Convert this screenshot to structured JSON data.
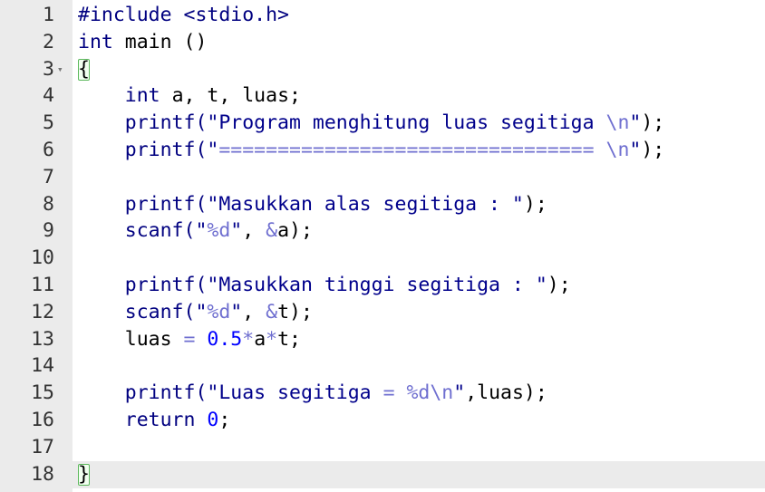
{
  "active_line": 18,
  "fold_line": 3,
  "fold_glyph": "▾",
  "lines": [
    {
      "n": "1",
      "tokens": [
        {
          "t": "#include <stdio.h>",
          "c": "kw"
        }
      ]
    },
    {
      "n": "2",
      "tokens": [
        {
          "t": "int",
          "c": "kw"
        },
        {
          "t": " main ()",
          "c": ""
        }
      ]
    },
    {
      "n": "3",
      "tokens": [
        {
          "t": "{",
          "c": "brace"
        }
      ]
    },
    {
      "n": "4",
      "tokens": [
        {
          "t": "    ",
          "c": ""
        },
        {
          "t": "int",
          "c": "kw"
        },
        {
          "t": " a, t, luas;",
          "c": ""
        }
      ]
    },
    {
      "n": "5",
      "tokens": [
        {
          "t": "    ",
          "c": ""
        },
        {
          "t": "printf(",
          "c": "kw"
        },
        {
          "t": "\"Program menghitung luas segitiga ",
          "c": "str"
        },
        {
          "t": "\\n",
          "c": "esc"
        },
        {
          "t": "\"",
          "c": "str"
        },
        {
          "t": ");",
          "c": ""
        }
      ]
    },
    {
      "n": "6",
      "tokens": [
        {
          "t": "    ",
          "c": ""
        },
        {
          "t": "printf(",
          "c": "kw"
        },
        {
          "t": "\"",
          "c": "str"
        },
        {
          "t": "================================",
          "c": "op"
        },
        {
          "t": " ",
          "c": "str"
        },
        {
          "t": "\\n",
          "c": "esc"
        },
        {
          "t": "\"",
          "c": "str"
        },
        {
          "t": ");",
          "c": ""
        }
      ]
    },
    {
      "n": "7",
      "tokens": []
    },
    {
      "n": "8",
      "tokens": [
        {
          "t": "    ",
          "c": ""
        },
        {
          "t": "printf(",
          "c": "kw"
        },
        {
          "t": "\"Masukkan alas segitiga : \"",
          "c": "str"
        },
        {
          "t": ");",
          "c": ""
        }
      ]
    },
    {
      "n": "9",
      "tokens": [
        {
          "t": "    ",
          "c": ""
        },
        {
          "t": "scanf(",
          "c": "kw"
        },
        {
          "t": "\"",
          "c": "str"
        },
        {
          "t": "%d",
          "c": "fmt"
        },
        {
          "t": "\"",
          "c": "str"
        },
        {
          "t": ", ",
          "c": ""
        },
        {
          "t": "&",
          "c": "op"
        },
        {
          "t": "a);",
          "c": ""
        }
      ]
    },
    {
      "n": "10",
      "tokens": []
    },
    {
      "n": "11",
      "tokens": [
        {
          "t": "    ",
          "c": ""
        },
        {
          "t": "printf(",
          "c": "kw"
        },
        {
          "t": "\"Masukkan tinggi segitiga : \"",
          "c": "str"
        },
        {
          "t": ");",
          "c": ""
        }
      ]
    },
    {
      "n": "12",
      "tokens": [
        {
          "t": "    ",
          "c": ""
        },
        {
          "t": "scanf(",
          "c": "kw"
        },
        {
          "t": "\"",
          "c": "str"
        },
        {
          "t": "%d",
          "c": "fmt"
        },
        {
          "t": "\"",
          "c": "str"
        },
        {
          "t": ", ",
          "c": ""
        },
        {
          "t": "&",
          "c": "op"
        },
        {
          "t": "t);",
          "c": ""
        }
      ]
    },
    {
      "n": "13",
      "tokens": [
        {
          "t": "    luas ",
          "c": ""
        },
        {
          "t": "=",
          "c": "op"
        },
        {
          "t": " ",
          "c": ""
        },
        {
          "t": "0.5",
          "c": "num"
        },
        {
          "t": "*",
          "c": "op"
        },
        {
          "t": "a",
          "c": ""
        },
        {
          "t": "*",
          "c": "op"
        },
        {
          "t": "t;",
          "c": ""
        }
      ]
    },
    {
      "n": "14",
      "tokens": []
    },
    {
      "n": "15",
      "tokens": [
        {
          "t": "    ",
          "c": ""
        },
        {
          "t": "printf(",
          "c": "kw"
        },
        {
          "t": "\"Luas segitiga ",
          "c": "str"
        },
        {
          "t": "=",
          "c": "op"
        },
        {
          "t": " ",
          "c": "str"
        },
        {
          "t": "%d\\n",
          "c": "fmt"
        },
        {
          "t": "\"",
          "c": "str"
        },
        {
          "t": ",luas);",
          "c": ""
        }
      ]
    },
    {
      "n": "16",
      "tokens": [
        {
          "t": "    ",
          "c": ""
        },
        {
          "t": "return",
          "c": "kw"
        },
        {
          "t": " ",
          "c": ""
        },
        {
          "t": "0",
          "c": "num"
        },
        {
          "t": ";",
          "c": ""
        }
      ]
    },
    {
      "n": "17",
      "tokens": []
    },
    {
      "n": "18",
      "tokens": [
        {
          "t": "}",
          "c": "brace"
        }
      ]
    }
  ]
}
